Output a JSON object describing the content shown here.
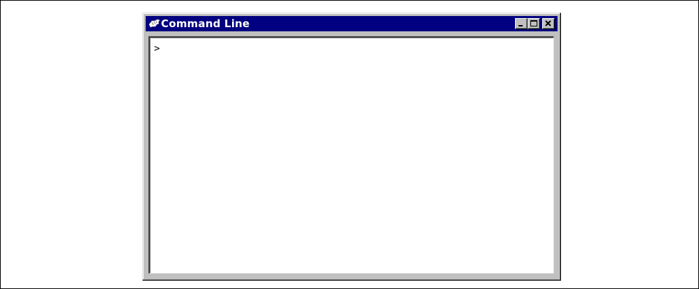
{
  "window": {
    "title": "Command Line",
    "icon": "command-line-app-icon",
    "controls": {
      "minimize_icon": "minimize-icon",
      "maximize_icon": "maximize-icon",
      "close_icon": "close-icon"
    }
  },
  "console": {
    "prompt": ">"
  },
  "colors": {
    "titlebar": "#000080",
    "window_face": "#c0c0c0",
    "client_background": "#ffffff"
  }
}
